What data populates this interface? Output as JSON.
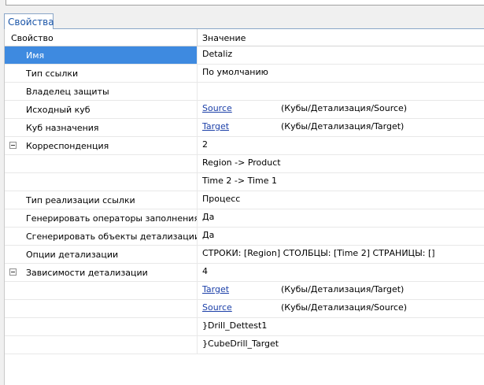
{
  "tab": {
    "label": "Свойства"
  },
  "header": {
    "property": "Свойство",
    "value": "Значение"
  },
  "rows": {
    "name": {
      "label": "Имя",
      "value": "Detaliz"
    },
    "link_type": {
      "label": "Тип ссылки",
      "value": "По умолчанию"
    },
    "owner": {
      "label": "Владелец защиты",
      "value": ""
    },
    "source_cube": {
      "label": "Исходный куб",
      "link": "Source",
      "path": "(Кубы/Детализация/Source)"
    },
    "target_cube": {
      "label": "Куб назначения",
      "link": "Target",
      "path": "(Кубы/Детализация/Target)"
    },
    "correspondence": {
      "label": "Корреспонденция",
      "value": "2",
      "items": [
        "Region -> Product",
        "Time 2 -> Time 1"
      ]
    },
    "impl_type": {
      "label": "Тип реализации ссылки",
      "value": "Процесс"
    },
    "gen_fill": {
      "label": "Генерировать операторы заполнения?",
      "value": "Да"
    },
    "gen_objects": {
      "label": "Сгенерировать объекты детализации?",
      "value": "Да"
    },
    "options": {
      "label": "Опции детализации",
      "value": "СТРОКИ: [Region] СТОЛБЦЫ: [Time 2] СТРАНИЦЫ: []"
    },
    "dependencies": {
      "label": "Зависимости детализации",
      "value": "4",
      "target_link": "Target",
      "target_path": "(Кубы/Детализация/Target)",
      "source_link": "Source",
      "source_path": "(Кубы/Детализация/Source)",
      "item3": "}Drill_Dettest1",
      "item4": "}CubeDrill_Target"
    }
  }
}
